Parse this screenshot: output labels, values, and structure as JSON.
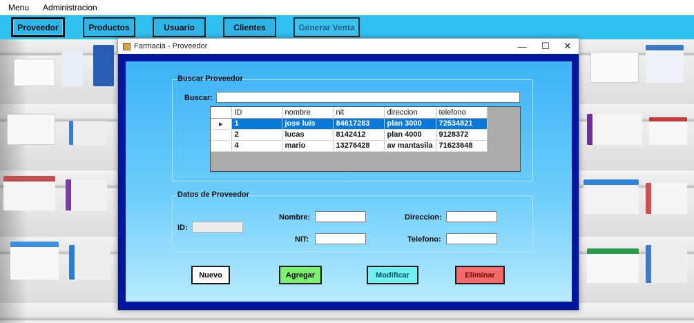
{
  "menubar": {
    "items": [
      "Menu",
      "Administracion"
    ]
  },
  "toolbar": {
    "buttons": [
      "Proveedor",
      "Productos",
      "Usuario",
      "Clientes",
      "Generar Venta"
    ]
  },
  "window": {
    "title": "Farmacia - Proveedor",
    "controls": {
      "minimize": "—",
      "maximize": "☐",
      "close": "✕"
    }
  },
  "search": {
    "group_title": "Buscar Proveedor",
    "label": "Buscar:",
    "value": ""
  },
  "table": {
    "columns": [
      "ID",
      "nombre",
      "nit",
      "direccion",
      "telefono"
    ],
    "selected_row_marker": "▸",
    "rows": [
      [
        "1",
        "jose luis",
        "84617283",
        "plan 3000",
        "72534821"
      ],
      [
        "2",
        "lucas",
        "8142412",
        "plan 4000",
        "9128372"
      ],
      [
        "4",
        "mario",
        "13276428",
        "av mantasila",
        "71623648"
      ]
    ]
  },
  "form": {
    "group_title": "Datos de Proveedor",
    "id_label": "ID:",
    "nombre_label": "Nombre:",
    "nit_label": "NIT:",
    "direccion_label": "Direccion:",
    "telefono_label": "Telefono:"
  },
  "actions": {
    "nuevo": "Nuevo",
    "agregar": "Agregar",
    "modificar": "Modificar",
    "eliminar": "Eliminar"
  },
  "colors": {
    "toolbar": "#2fc1f0",
    "window_frame": "#00169d",
    "selection": "#0a78d6",
    "agregar": "#7bf26f",
    "modificar": "#6ef1ef",
    "eliminar": "#f26a6a",
    "nuevo": "#ffffff"
  }
}
